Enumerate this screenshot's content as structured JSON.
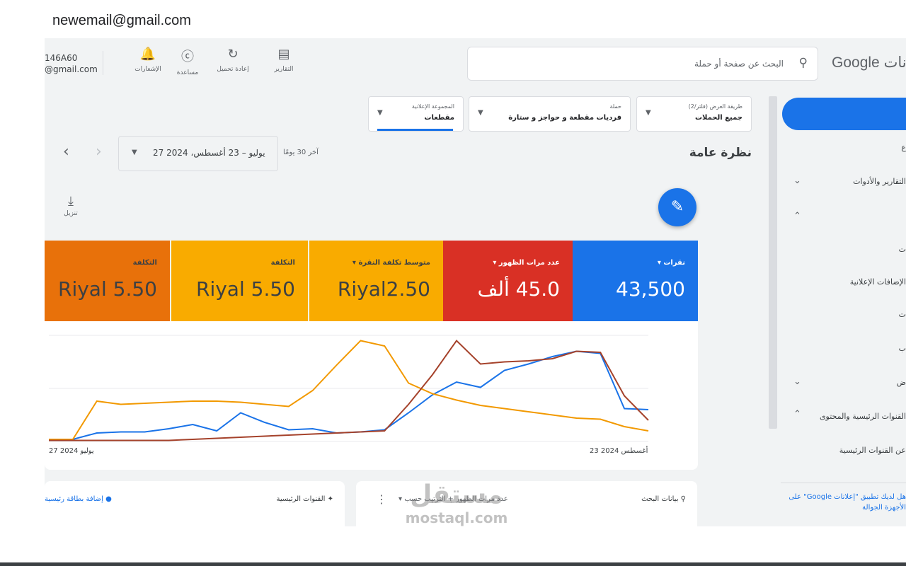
{
  "email_header": "newemail@gmail.com",
  "topbar": {
    "account_id": "146A60",
    "account_email": "@gmail.com",
    "tools": [
      "الإشعارات",
      "مساعدة",
      "إعادة تحميل",
      "التقارير"
    ],
    "search_placeholder": "البحث عن صفحة أو حملة",
    "brand": "Google اعلانات"
  },
  "nav": {
    "items": [
      "ع",
      "التقارير والأدوات",
      "",
      "ت",
      "الإضافات الإعلانية",
      "ت",
      "ب",
      "ض",
      "القنوات الرئيسية والمحتوى",
      "عن القنوات الرئيسية"
    ],
    "footer": "هل لديك تطبيق \"إعلانات Google\" على الأجهزة الجوالة"
  },
  "filters": [
    {
      "label": "طريقة العرض (فلتر/2)",
      "value": "جميع الحملات"
    },
    {
      "label": "حملة",
      "value": "فرديات مقطعة و حواجز و ستارة"
    },
    {
      "label": "المجموعة الإعلانية",
      "value": "مقطعات"
    }
  ],
  "overview": {
    "title": "نظرة عامة",
    "range_label": "آخر 30 يومًا",
    "date_range": "27 يوليو – 23 أغسطس، 2024",
    "download_label": "تنزيل"
  },
  "metrics": [
    {
      "label": "نقرات",
      "value": "43,500",
      "color": "#1a73e8"
    },
    {
      "label": "عدد مرات الظهور",
      "value": "45.0 ألف",
      "color": "#d93025"
    },
    {
      "label": "متوسط تكلفة النقرة",
      "value": "Riyal2.50",
      "color": "#f9ab00"
    },
    {
      "label": "التكلفة",
      "value": "Riyal 5.50",
      "color": "#f9ab00"
    },
    {
      "label": "التكلفة",
      "value": "Riyal 5.50",
      "color": "#e8710a"
    }
  ],
  "chart_data": {
    "type": "line",
    "x_start": "27 يوليو 2024",
    "x_end": "23 أغسطس 2024",
    "series": [
      {
        "color": "#1a73e8",
        "values": [
          2,
          2,
          8,
          9,
          9,
          12,
          16,
          10,
          27,
          18,
          11,
          12,
          8,
          9,
          11,
          27,
          44,
          56,
          51,
          67,
          73,
          80,
          85,
          83,
          31,
          30
        ]
      },
      {
        "color": "#f29900",
        "values": [
          2,
          2,
          38,
          35,
          36,
          37,
          38,
          38,
          37,
          35,
          33,
          48,
          72,
          95,
          90,
          55,
          45,
          39,
          34,
          31,
          28,
          25,
          22,
          21,
          14,
          10
        ]
      },
      {
        "color": "#a5422b",
        "values": [
          1,
          1,
          1,
          1,
          1,
          1,
          2,
          3,
          4,
          5,
          6,
          7,
          8,
          9,
          10,
          35,
          63,
          95,
          73,
          75,
          76,
          78,
          85,
          84,
          43,
          20
        ]
      }
    ]
  },
  "bottom": {
    "search_label": "بيانات البحث",
    "sort_label": "الترتيب حسب",
    "sort_value": "عدد مرات الظهور",
    "channels_label": "القنوات الرئيسية",
    "add_label": "إضافة بطاقة رئيسية"
  },
  "watermark": {
    "ar": "مستقل",
    "en": "mostaql.com"
  }
}
